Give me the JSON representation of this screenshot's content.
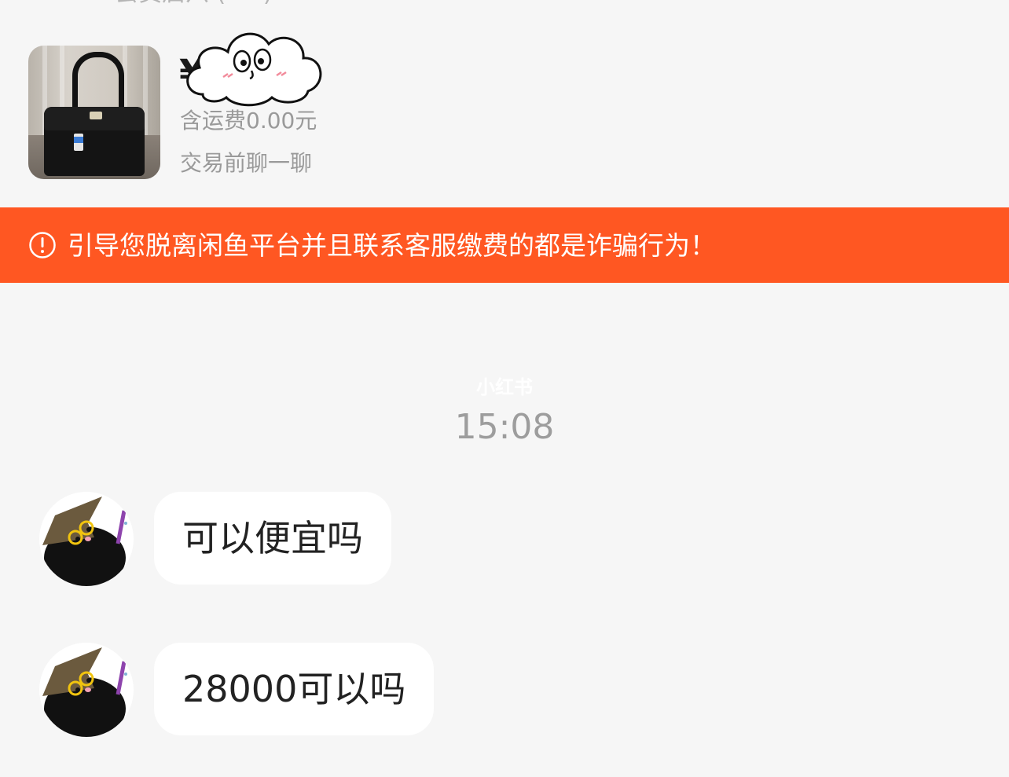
{
  "header": {
    "clipped_text": "会员启六 (  ·  ·  )"
  },
  "product": {
    "image_label": "black leather handbag",
    "price_visible": "¥        00",
    "shipping": "含运费0.00元",
    "chat_hint": "交易前聊一聊",
    "sticker": "cloud-face-sticker"
  },
  "warning": {
    "text": "引导您脱离闲鱼平台并且联系客服缴费的都是诈骗行为！",
    "icon": "exclamation-circle-icon",
    "background": "#ff5722"
  },
  "watermark": "小红书",
  "timestamp": "15:08",
  "messages": [
    {
      "text": "可以便宜吗",
      "avatar": "witch-hat-cat-avatar"
    },
    {
      "text": "28000可以吗",
      "avatar": "witch-hat-cat-avatar"
    }
  ]
}
